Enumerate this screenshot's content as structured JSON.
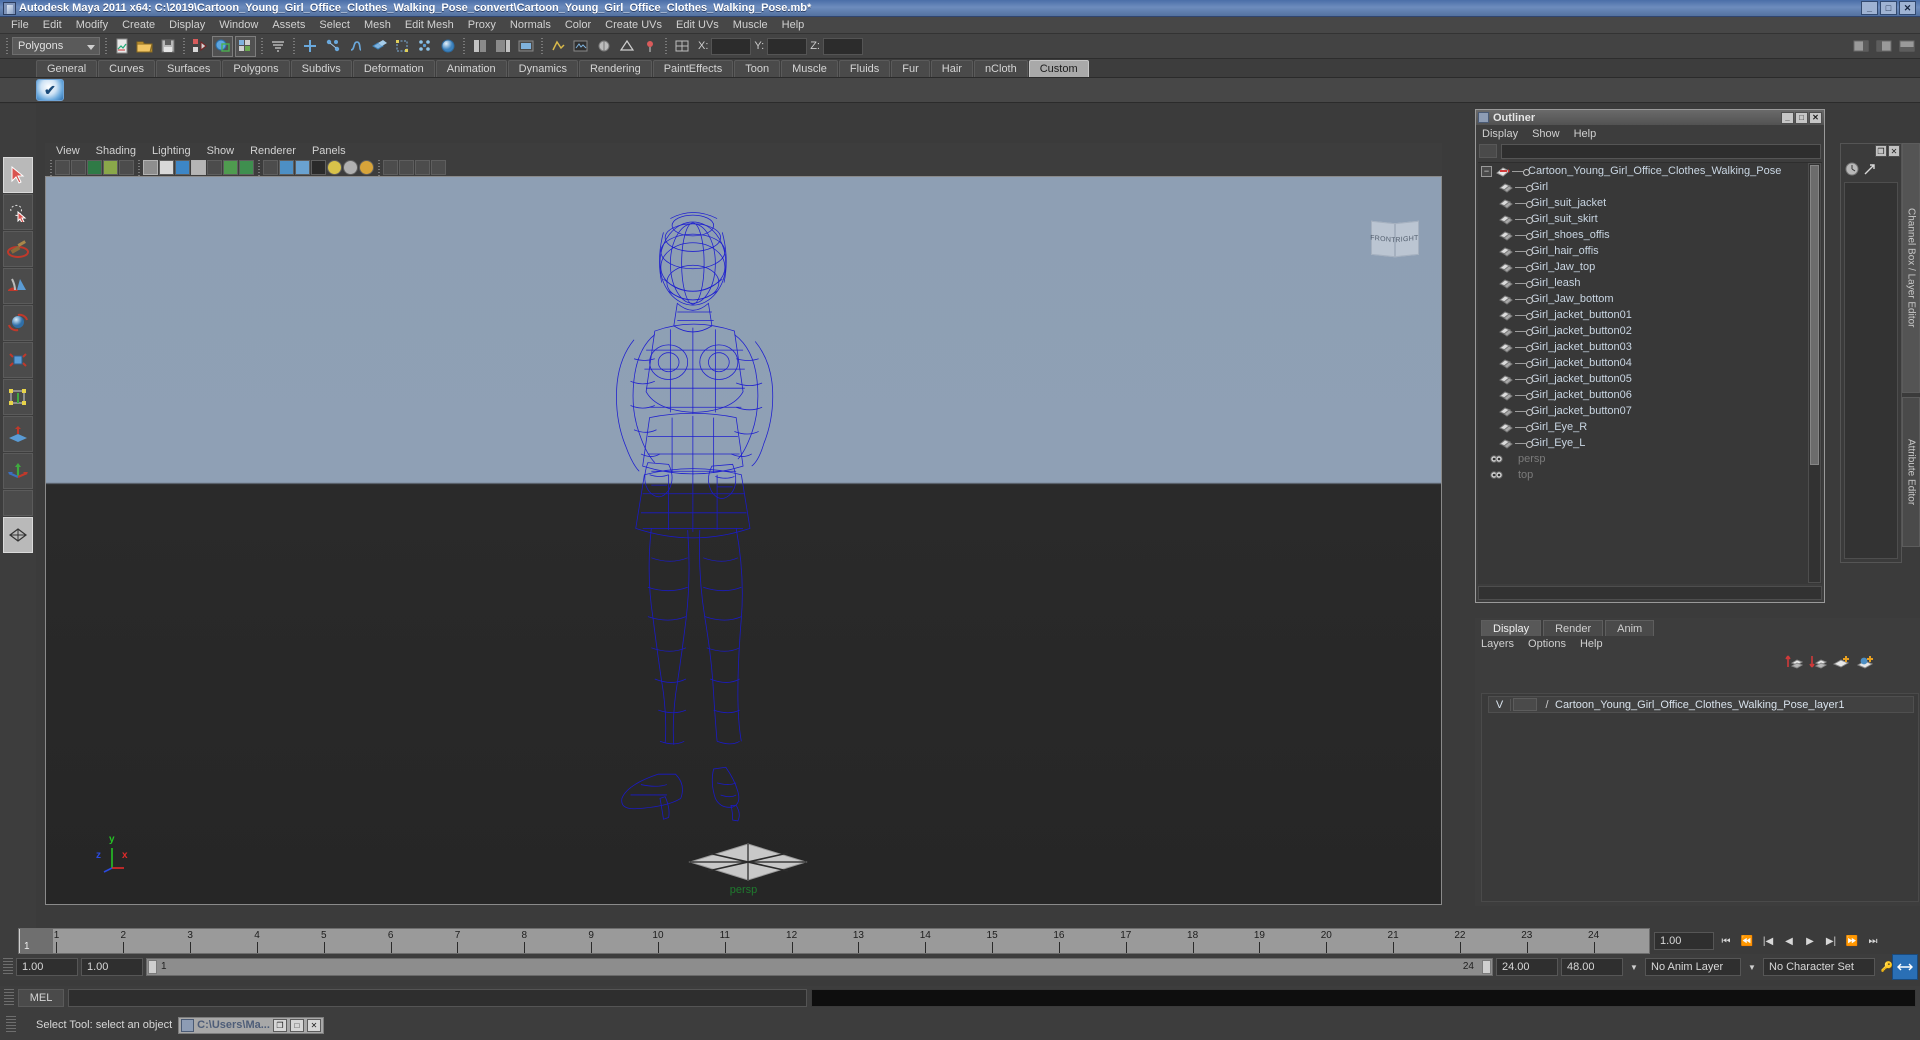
{
  "window": {
    "title": "Autodesk Maya 2011 x64: C:\\2019\\Cartoon_Young_Girl_Office_Clothes_Walking_Pose_convert\\Cartoon_Young_Girl_Office_Clothes_Walking_Pose.mb*",
    "minimize": "_",
    "maximize": "□",
    "close": "✕"
  },
  "menubar": {
    "items": [
      "File",
      "Edit",
      "Modify",
      "Create",
      "Display",
      "Window",
      "Assets",
      "Select",
      "Mesh",
      "Edit Mesh",
      "Proxy",
      "Normals",
      "Color",
      "Create UVs",
      "Edit UVs",
      "Muscle",
      "Help"
    ]
  },
  "statusline": {
    "mode_selected": "Polygons",
    "coord_x_label": "X:",
    "coord_y_label": "Y:",
    "coord_z_label": "Z:",
    "coord_x_value": "",
    "coord_y_value": "",
    "coord_z_value": ""
  },
  "shelf": {
    "tabs": [
      "General",
      "Curves",
      "Surfaces",
      "Polygons",
      "Subdivs",
      "Deformation",
      "Animation",
      "Dynamics",
      "Rendering",
      "PaintEffects",
      "Toon",
      "Muscle",
      "Fluids",
      "Fur",
      "Hair",
      "nCloth",
      "Custom"
    ],
    "active_tab": "Custom",
    "button_glyph": "✔"
  },
  "viewport": {
    "menus": [
      "View",
      "Shading",
      "Lighting",
      "Show",
      "Renderer",
      "Panels"
    ],
    "camera_label": "persp",
    "viewcube_front": "FRONT",
    "viewcube_right": "RIGHT",
    "axis_y": "y",
    "axis_x": "x",
    "axis_z": "z",
    "model_color": "#1a1ad0",
    "bg_top": "#8e9fb4",
    "bg_bottom": "#282828"
  },
  "outliner": {
    "title": "Outliner",
    "minimize": "_",
    "maximize": "□",
    "close": "✕",
    "menus": [
      "Display",
      "Show",
      "Help"
    ],
    "search_value": "",
    "root": "Cartoon_Young_Girl_Office_Clothes_Walking_Pose",
    "children": [
      "Girl",
      "Girl_suit_jacket",
      "Girl_suit_skirt",
      "Girl_shoes_offis",
      "Girl_hair_offis",
      "Girl_Jaw_top",
      "Girl_leash",
      "Girl_Jaw_bottom",
      "Girl_jacket_button01",
      "Girl_jacket_button02",
      "Girl_jacket_button03",
      "Girl_jacket_button04",
      "Girl_jacket_button05",
      "Girl_jacket_button06",
      "Girl_jacket_button07",
      "Girl_Eye_R",
      "Girl_Eye_L"
    ],
    "cameras": [
      "persp",
      "top"
    ],
    "expand_glyph": "−"
  },
  "layer_editor": {
    "tabs": [
      "Display",
      "Render",
      "Anim"
    ],
    "active_tab": "Display",
    "menus": [
      "Layers",
      "Options",
      "Help"
    ],
    "layers": [
      {
        "visibility": "V",
        "mode": "",
        "name": "Cartoon_Young_Girl_Office_Clothes_Walking_Pose_layer1"
      }
    ]
  },
  "right_tabs": {
    "items": [
      "Channel Box / Layer Editor",
      "Attribute Editor"
    ],
    "active": "Channel Box / Layer Editor"
  },
  "timeline": {
    "ticks": [
      "1",
      "2",
      "3",
      "4",
      "5",
      "6",
      "7",
      "8",
      "9",
      "10",
      "11",
      "12",
      "13",
      "14",
      "15",
      "16",
      "17",
      "18",
      "19",
      "20",
      "21",
      "22",
      "23",
      "24"
    ],
    "current_frame": "1",
    "current_frame_field": "1.00"
  },
  "playback": {
    "buttons": [
      "⏮",
      "⏪",
      "|◀",
      "◀",
      "▶",
      "▶|",
      "⏩",
      "⏭"
    ]
  },
  "range": {
    "start_field": "1.00",
    "anim_start_field": "1.00",
    "slider_min": "1",
    "slider_max": "24",
    "end_field": "24.00",
    "anim_end_field": "48.00",
    "anim_layer": "No Anim Layer",
    "character_set": "No Character Set"
  },
  "command_line": {
    "language": "MEL",
    "input_value": "",
    "output_value": ""
  },
  "helpline": {
    "text": "Select Tool: select an object",
    "taskbar_item": "C:\\Users\\Ma...",
    "taskbar_restore": "❐",
    "taskbar_max": "□",
    "taskbar_close": "✕"
  },
  "toolbox": {
    "items": [
      "select-tool",
      "lasso-select-tool",
      "paint-select-tool",
      "sculpt-tool",
      "rotate-tool",
      "scale-tool",
      "universal-manipulator",
      "soft-mod-tool",
      "move-tool",
      "blank-slot",
      "smooth-shade-all"
    ]
  }
}
